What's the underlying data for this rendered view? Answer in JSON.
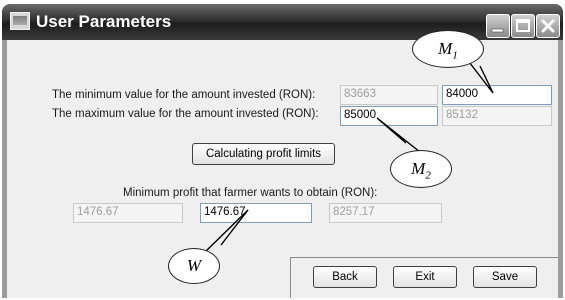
{
  "window": {
    "title": "User Parameters",
    "controls": [
      "minimize",
      "maximize",
      "close"
    ]
  },
  "form": {
    "min_label": "The minimum value for the amount invested (RON):",
    "min_lower_value": "83663",
    "min_input_value": "84000",
    "max_label": "The maximum value for the amount invested (RON):",
    "max_input_value": "85000",
    "max_upper_value": "85132",
    "calc_button": "Calculating profit limits",
    "profit_label": "Minimum profit that farmer wants to obtain (RON):",
    "profit_lower_value": "1476.67",
    "profit_input_value": "1476.67",
    "profit_upper_value": "8257.17"
  },
  "buttons": {
    "back": "Back",
    "exit": "Exit",
    "save": "Save"
  },
  "annotations": {
    "m1_main": "M",
    "m1_sub": "1",
    "m2_main": "M",
    "m2_sub": "2",
    "w": "W"
  }
}
